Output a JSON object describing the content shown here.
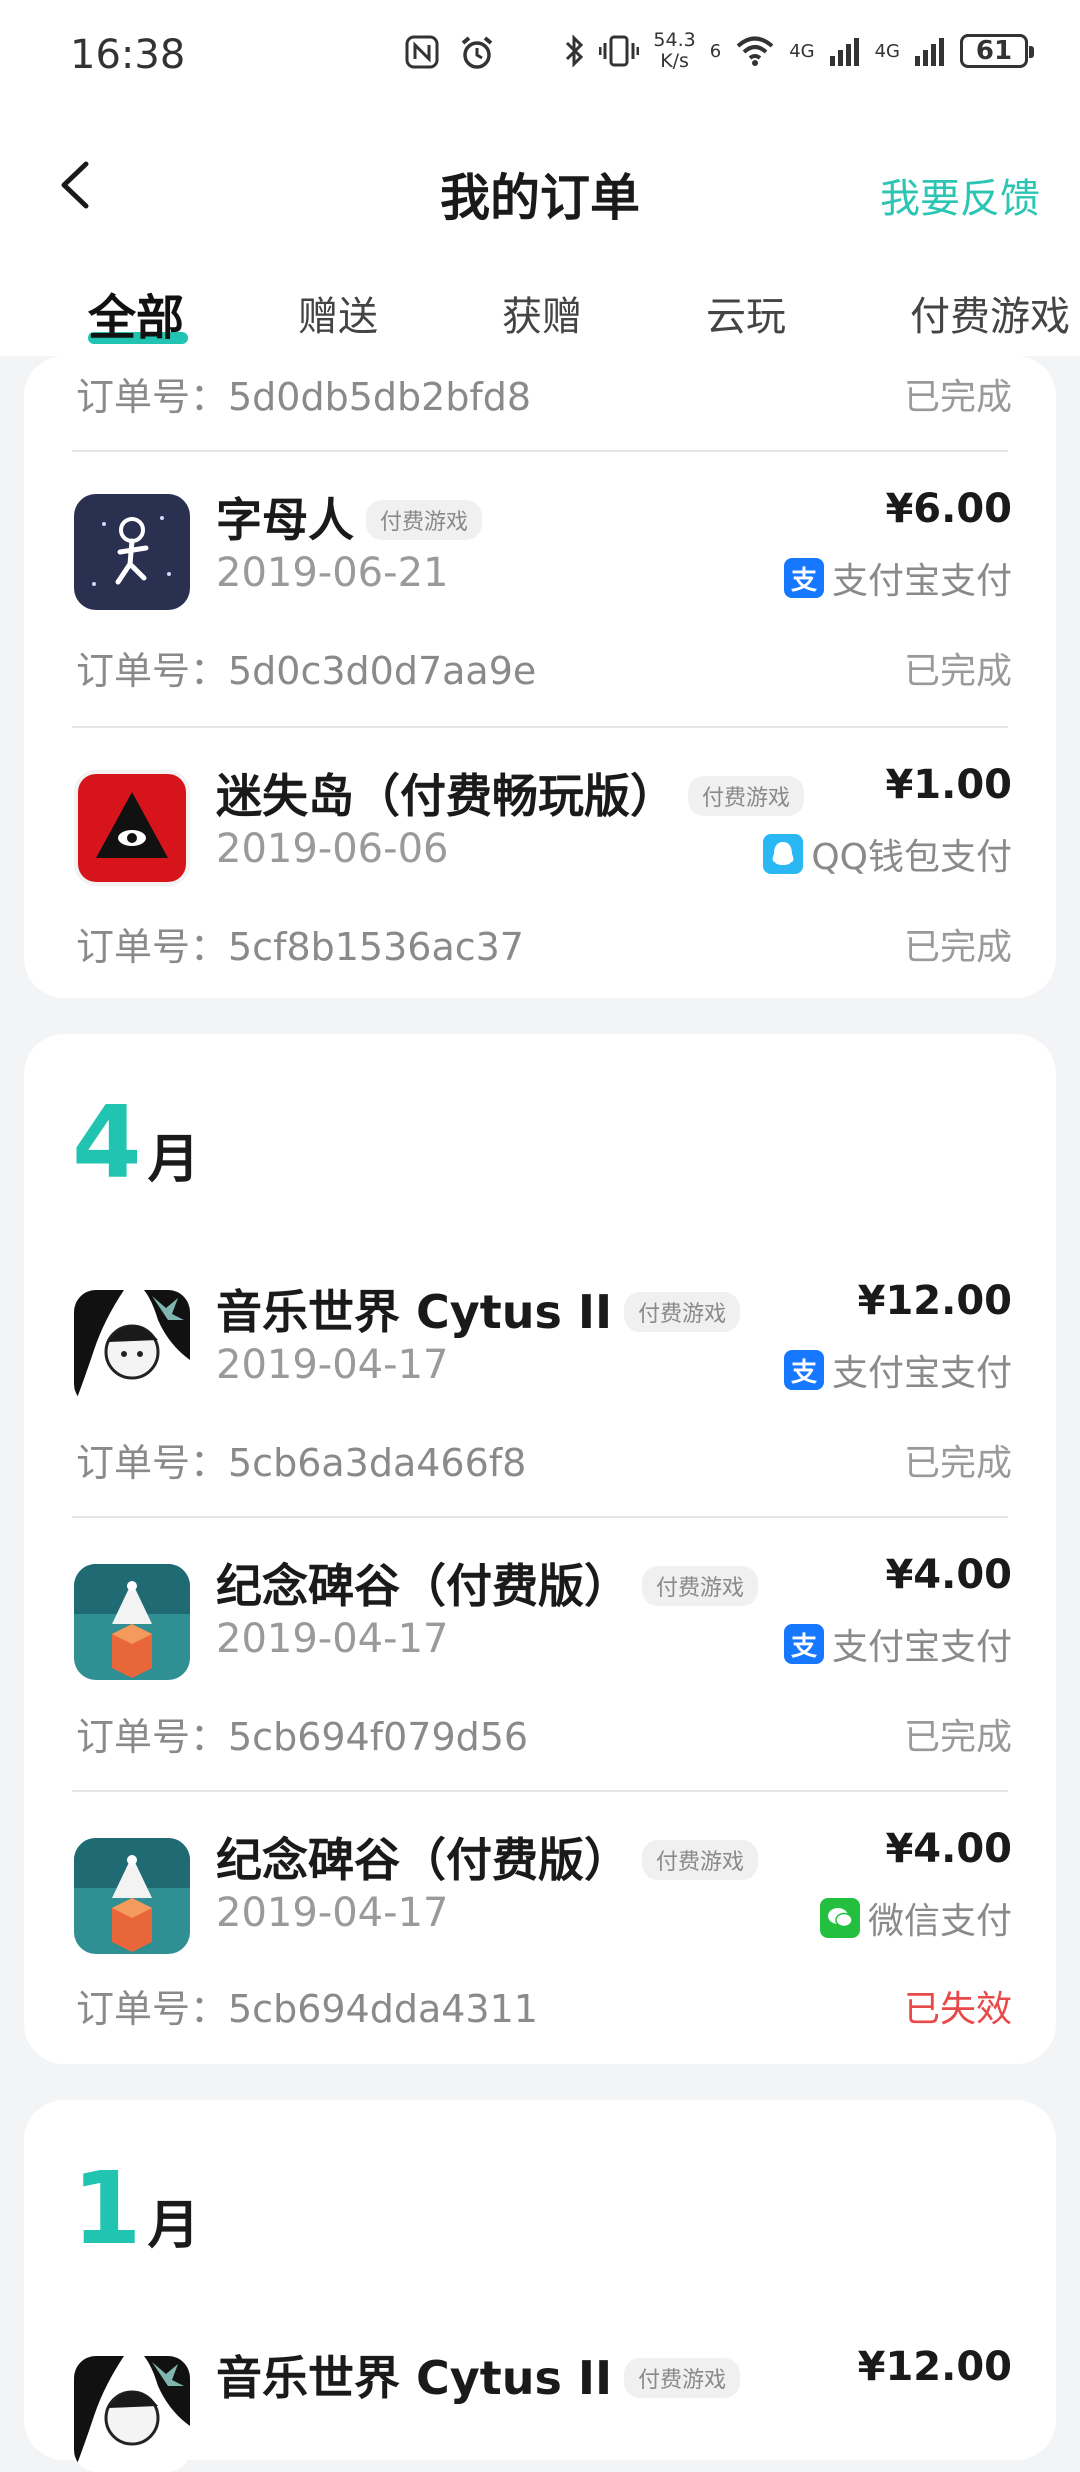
{
  "status_bar": {
    "time": "16:38",
    "net_speed_value": "54.3",
    "net_speed_unit": "K/s",
    "wifi_label": "6",
    "sim1_label": "4G",
    "sim2_label": "4G",
    "battery": "61"
  },
  "header": {
    "title": "我的订单",
    "feedback": "我要反馈"
  },
  "tabs": [
    {
      "label": "全部",
      "active": true
    },
    {
      "label": "赠送"
    },
    {
      "label": "获赠"
    },
    {
      "label": "云玩"
    },
    {
      "label": "付费游戏"
    }
  ],
  "colors": {
    "accent": "#20c4b0",
    "feedback": "#2bc5b4",
    "failed": "#e84a4a",
    "alipay": "#1677ff",
    "qq": "#2ab8f5",
    "wechat": "#22c03e"
  },
  "partial_top_order": {
    "order_no": "订单号：5d0db5db2bfd8",
    "status": "已完成"
  },
  "orders_group1": [
    {
      "name": "字母人",
      "tag": "付费游戏",
      "date": "2019-06-21",
      "price": "¥6.00",
      "pay_icon_glyph": "支",
      "pay_method": "支付宝支付",
      "order_no": "订单号：5d0c3d0d7aa9e",
      "status": "已完成"
    },
    {
      "name": "迷失岛（付费畅玩版）",
      "tag": "付费游戏",
      "date": "2019-06-06",
      "price": "¥1.00",
      "pay_method": "QQ钱包支付",
      "order_no": "订单号：5cf8b1536ac37",
      "status": "已完成"
    }
  ],
  "month_april": {
    "num": "4",
    "unit": "月"
  },
  "orders_april": [
    {
      "name": "音乐世界 Cytus II",
      "tag": "付费游戏",
      "date": "2019-04-17",
      "price": "¥12.00",
      "pay_icon_glyph": "支",
      "pay_method": "支付宝支付",
      "order_no": "订单号：5cb6a3da466f8",
      "status": "已完成"
    },
    {
      "name": "纪念碑谷（付费版）",
      "tag": "付费游戏",
      "date": "2019-04-17",
      "price": "¥4.00",
      "pay_icon_glyph": "支",
      "pay_method": "支付宝支付",
      "order_no": "订单号：5cb694f079d56",
      "status": "已完成"
    },
    {
      "name": "纪念碑谷（付费版）",
      "tag": "付费游戏",
      "date": "2019-04-17",
      "price": "¥4.00",
      "pay_method": "微信支付",
      "order_no": "订单号：5cb694dda4311",
      "status": "已失效"
    }
  ],
  "month_january": {
    "num": "1",
    "unit": "月"
  },
  "orders_january": [
    {
      "name": "音乐世界 Cytus II",
      "tag": "付费游戏",
      "price": "¥12.00"
    }
  ]
}
